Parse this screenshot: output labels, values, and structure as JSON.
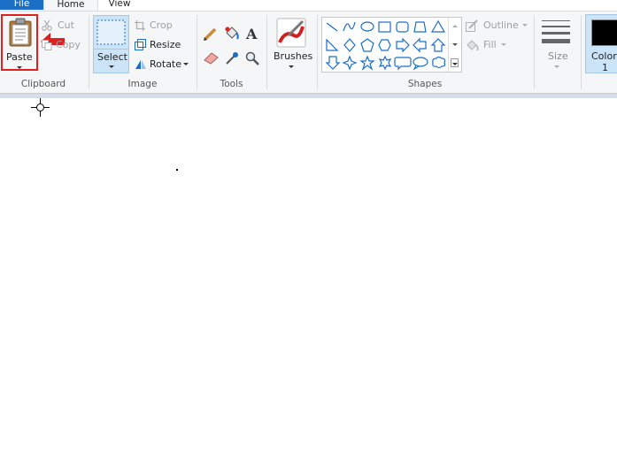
{
  "tabs": {
    "file": "File",
    "home": "Home",
    "view": "View"
  },
  "clipboard": {
    "paste": "Paste",
    "cut": "Cut",
    "copy": "Copy",
    "group_label": "Clipboard"
  },
  "image": {
    "select": "Select",
    "crop": "Crop",
    "resize": "Resize",
    "rotate": "Rotate",
    "group_label": "Image"
  },
  "tools": {
    "group_label": "Tools"
  },
  "brushes": {
    "label": "Brushes"
  },
  "shapes": {
    "outline": "Outline",
    "fill": "Fill",
    "group_label": "Shapes"
  },
  "size": {
    "label": "Size"
  },
  "color1": {
    "label_line1": "Color",
    "label_line2": "1",
    "value": "#000000"
  },
  "colors": {
    "accent": "#1c6fc7",
    "highlight": "#e02020"
  }
}
